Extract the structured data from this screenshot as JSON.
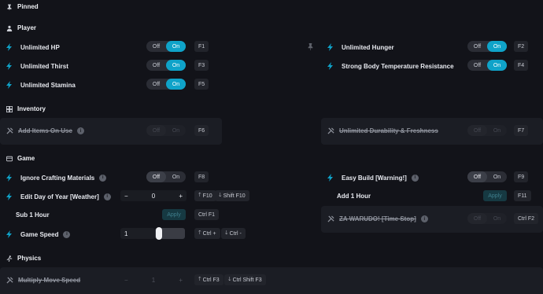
{
  "sections": {
    "pinned": "Pinned",
    "player": "Player",
    "inventory": "Inventory",
    "game": "Game",
    "physics": "Physics"
  },
  "toggle": {
    "off": "Off",
    "on": "On"
  },
  "player": {
    "unlimited_hp": {
      "label": "Unlimited HP",
      "key": "F1"
    },
    "unlimited_thirst": {
      "label": "Unlimited Thirst",
      "key": "F3"
    },
    "unlimited_stamina": {
      "label": "Unlimited Stamina",
      "key": "F5"
    },
    "unlimited_hunger": {
      "label": "Unlimited Hunger",
      "key": "F2"
    },
    "strong_body_temp": {
      "label": "Strong Body Temperature Resistance",
      "key": "F4"
    }
  },
  "inventory": {
    "add_items": {
      "label": "Add Items On Use",
      "key": "F6"
    },
    "unlimited_durability": {
      "label": "Unlimited Durability & Freshness",
      "key": "F7"
    }
  },
  "game": {
    "ignore_crafting": {
      "label": "Ignore Crafting Materials",
      "key": "F8"
    },
    "edit_day": {
      "label": "Edit Day of Year [Weather]",
      "value": "0",
      "key1": "F10",
      "key2": "Shift F10"
    },
    "sub_hour": {
      "label": "Sub 1 Hour",
      "apply": "Apply",
      "key": "Ctrl F1"
    },
    "game_speed": {
      "label": "Game Speed",
      "value": "1",
      "key1": "Ctrl +",
      "key2": "Ctrl -"
    },
    "easy_build": {
      "label": "Easy Build [Warning!]",
      "key": "F9"
    },
    "add_hour": {
      "label": "Add 1 Hour",
      "apply": "Apply",
      "key": "F11"
    },
    "za_warudo": {
      "label": "ZA WARUDO! [Time Stop]",
      "key": "Ctrl F2"
    }
  },
  "physics": {
    "multiply_move": {
      "label": "Multiply Move Speed",
      "value": "1",
      "key1": "Ctrl F3",
      "key2": "Ctrl Shift F3"
    }
  },
  "stepper": {
    "minus": "−",
    "plus": "+"
  },
  "colors": {
    "accent": "#0fa3c9",
    "bg": "#121319",
    "row": "#1b1d24"
  }
}
